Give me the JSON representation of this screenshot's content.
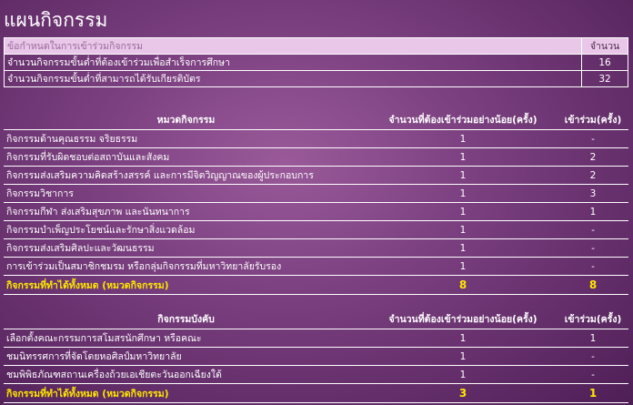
{
  "page": {
    "title": "แผนกิจกรรม"
  },
  "requirements": {
    "header_label": "ข้อกำหนดในการเข้าร่วมกิจกรรม",
    "header_value": "จำนวน",
    "rows": [
      {
        "label": "จำนวนกิจกรรมขั้นต่ำที่ต้องเข้าร่วมเพื่อสำเร็จการศึกษา",
        "value": "16"
      },
      {
        "label": "จำนวนกิจกรรมขั้นต่ำที่สามารถได้รับเกียรติบัตร",
        "value": "32"
      }
    ]
  },
  "category_table": {
    "col1": "หมวดกิจกรรม",
    "col2": "จำนวนที่ต้องเข้าร่วมอย่างน้อย(ครั้ง)",
    "col3": "เข้าร่วม(ครั้ง)",
    "rows": [
      {
        "name": "กิจกรรมด้านคุณธรรม จริยธรรม",
        "required": "1",
        "joined": "-"
      },
      {
        "name": "กิจกรรมที่รับผิดชอบต่อสถาบันและสังคม",
        "required": "1",
        "joined": "2"
      },
      {
        "name": "กิจกรรมส่งเสริมความคิดสร้างสรรค์ และการมีจิตวิญญาณของผู้ประกอบการ",
        "required": "1",
        "joined": "2"
      },
      {
        "name": "กิจกรรมวิชาการ",
        "required": "1",
        "joined": "3"
      },
      {
        "name": "กิจกรรมกีฬา ส่งเสริมสุขภาพ และนันทนาการ",
        "required": "1",
        "joined": "1"
      },
      {
        "name": "กิจกรรมบำเพ็ญประโยชน์และรักษาสิ่งแวดล้อม",
        "required": "1",
        "joined": "-"
      },
      {
        "name": "กิจกรรมส่งเสริมศิลปะและวัฒนธรรม",
        "required": "1",
        "joined": "-"
      },
      {
        "name": "การเข้าร่วมเป็นสมาชิกชมรม หรือกลุ่มกิจกรรมที่มหาวิทยาลัยรับรอง",
        "required": "1",
        "joined": "-"
      }
    ],
    "total": {
      "name": "กิจกรรมที่ทำได้ทั้งหมด (หมวดกิจกรรม)",
      "required": "8",
      "joined": "8"
    }
  },
  "mandatory_table": {
    "col1": "กิจกรรมบังคับ",
    "col2": "จำนวนที่ต้องเข้าร่วมอย่างน้อย(ครั้ง)",
    "col3": "เข้าร่วม(ครั้ง)",
    "rows": [
      {
        "name": "เลือกตั้งคณะกรรมการสโมสรนักศึกษา หรือคณะ",
        "required": "1",
        "joined": "1"
      },
      {
        "name": "ชมนิทรรศการที่จัดโดยหอศิลป์มหาวิทยาลัย",
        "required": "1",
        "joined": "-"
      },
      {
        "name": "ชมพิพิธภัณฑสถานเครื่องถ้วยเอเชียตะวันออกเฉียงใต้",
        "required": "1",
        "joined": "-"
      }
    ],
    "total": {
      "name": "กิจกรรมที่ทำได้ทั้งหมด (หมวดกิจกรรม)",
      "required": "3",
      "joined": "1"
    }
  }
}
